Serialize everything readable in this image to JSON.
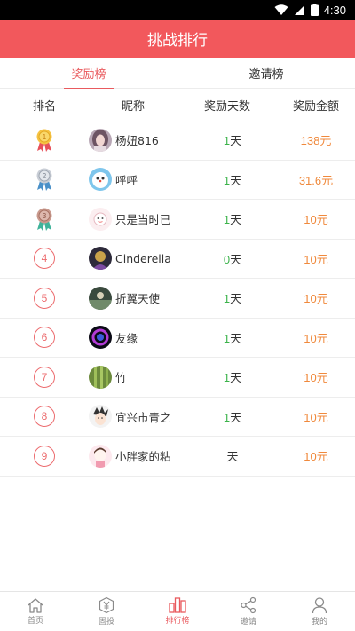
{
  "status": {
    "time": "4:30"
  },
  "title": "挑战排行",
  "tabs": [
    {
      "label": "奖励榜",
      "active": true
    },
    {
      "label": "邀请榜",
      "active": false
    }
  ],
  "table": {
    "headers": {
      "rank": "排名",
      "name": "昵称",
      "days": "奖励天数",
      "amount": "奖励金额"
    },
    "rows": [
      {
        "rank": "1",
        "medal": "gold-medal",
        "name": "杨妞816",
        "days": "1",
        "days_unit": "天",
        "amount": "138",
        "amount_unit": "元"
      },
      {
        "rank": "2",
        "medal": "silver-medal",
        "name": "呼呼",
        "days": "1",
        "days_unit": "天",
        "amount": "31.6",
        "amount_unit": "元"
      },
      {
        "rank": "3",
        "medal": "bronze-medal",
        "name": "只是当时已",
        "days": "1",
        "days_unit": "天",
        "amount": "10",
        "amount_unit": "元"
      },
      {
        "rank": "4",
        "name": "Cinderella",
        "days": "0",
        "days_unit": "天",
        "amount": "10",
        "amount_unit": "元"
      },
      {
        "rank": "5",
        "name": "折翼天使",
        "days": "1",
        "days_unit": "天",
        "amount": "10",
        "amount_unit": "元"
      },
      {
        "rank": "6",
        "name": "友缘",
        "days": "1",
        "days_unit": "天",
        "amount": "10",
        "amount_unit": "元"
      },
      {
        "rank": "7",
        "name": "竹",
        "days": "1",
        "days_unit": "天",
        "amount": "10",
        "amount_unit": "元"
      },
      {
        "rank": "8",
        "name": "宜兴市青之",
        "days": "1",
        "days_unit": "天",
        "amount": "10",
        "amount_unit": "元"
      },
      {
        "rank": "9",
        "name": "小胖家的粘",
        "days": "",
        "days_unit": "天",
        "amount": "10",
        "amount_unit": "元"
      }
    ]
  },
  "nav": [
    {
      "label": "首页",
      "icon": "home-icon",
      "active": false
    },
    {
      "label": "固投",
      "icon": "yen-icon",
      "active": false
    },
    {
      "label": "排行榜",
      "icon": "ranking-icon",
      "active": true
    },
    {
      "label": "邀请",
      "icon": "share-icon",
      "active": false
    },
    {
      "label": "我的",
      "icon": "user-icon",
      "active": false
    }
  ],
  "colors": {
    "primary": "#f2585c",
    "accent": "#e95a5e",
    "amount": "#f0893c",
    "days_green": "#3cb34b"
  }
}
